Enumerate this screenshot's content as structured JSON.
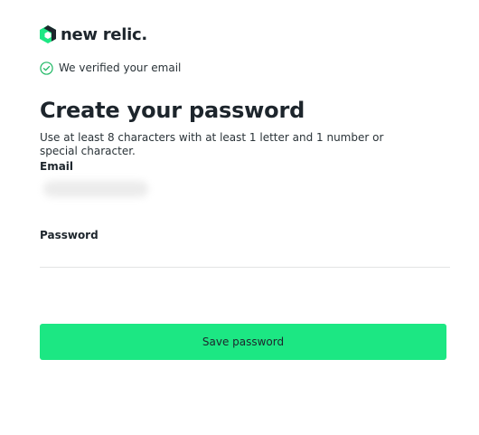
{
  "brand": {
    "name": "new relic.",
    "accent_color": "#1ce783",
    "logo_icon": "new-relic-hexagon-icon"
  },
  "verification": {
    "icon": "check-circle-icon",
    "text": "We verified your email"
  },
  "form": {
    "title": "Create your password",
    "hint": "Use at least 8 characters with at least 1 letter and 1 number or special character.",
    "email_label": "Email",
    "password_label": "Password",
    "password_value": "",
    "save_label": "Save password"
  }
}
